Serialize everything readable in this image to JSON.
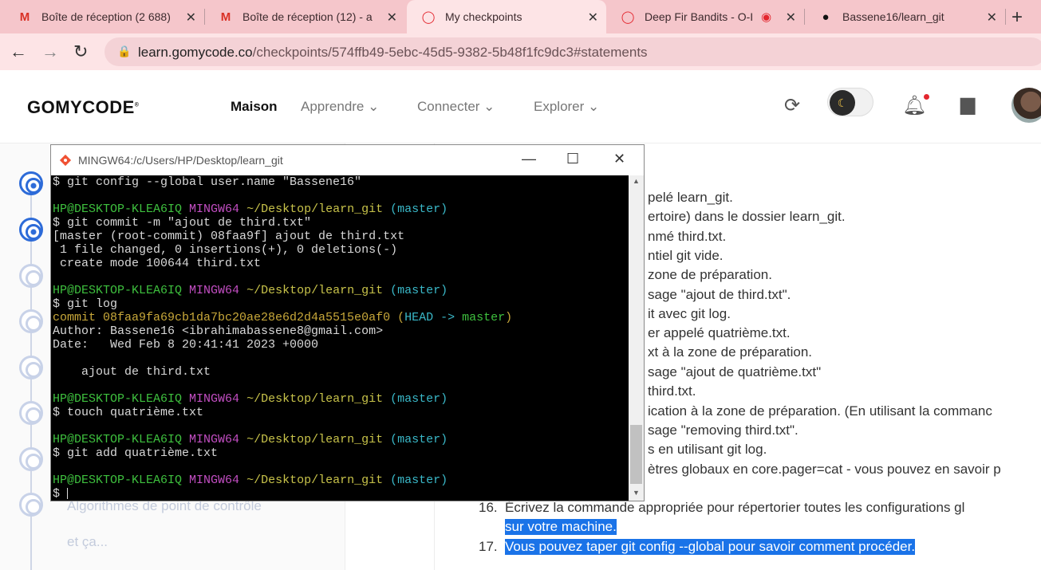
{
  "browser": {
    "tabs": [
      {
        "title": "Boîte de réception (2 688)",
        "icon": "gmail-icon"
      },
      {
        "title": "Boîte de réception (12) - a",
        "icon": "gmail-icon"
      },
      {
        "title": "My checkpoints",
        "icon": "gomycode-icon"
      },
      {
        "title": "Deep Fir Bandits - O-I",
        "icon": "gomycode-icon"
      },
      {
        "title": "Bassene16/learn_git",
        "icon": "github-icon"
      }
    ],
    "url_host": "learn.gomycode.co",
    "url_path": "/checkpoints/574ffb49-5ebc-45d5-9382-5b48f1fc9dc3#statements"
  },
  "site": {
    "logo": "GOMYCODE",
    "nav": [
      "Maison",
      "Apprendre",
      "Connecter",
      "Explorer"
    ]
  },
  "left": {
    "labels": [
      "Algorithmes de point de contrôle",
      "et ça..."
    ]
  },
  "statements": {
    "partial": [
      "pelé learn_git.",
      "ertoire) dans le dossier learn_git.",
      "nmé third.txt.",
      "ntiel git vide.",
      " zone de préparation.",
      "sage \"ajout de third.txt\".",
      "it avec git log.",
      "er appelé quatrième.txt.",
      "xt à la zone de préparation.",
      "sage \"ajout de quatrième.txt\"",
      " third.txt.",
      "ication à la zone de préparation. (En utilisant la commanc",
      "sage \"removing third.txt\".",
      "s en utilisant git log.",
      "ètres globaux en core.pager=cat - vous pouvez en savoir p"
    ],
    "item16_num": "16.",
    "item16_line1": "Écrivez la commande appropriée pour répertorier toutes les configurations gl",
    "item16_line2": "sur votre machine.",
    "item17_num": "17.",
    "item17_text": "Vous pouvez taper git config --global pour savoir comment procéder."
  },
  "terminal": {
    "title": "MINGW64:/c/Users/HP/Desktop/learn_git",
    "prompt_user": "HP@DESKTOP-KLEA6IQ",
    "prompt_env": "MINGW64",
    "prompt_path": "~/Desktop/learn_git",
    "prompt_branch": "(master)",
    "cmd1": "$ git config --global user.name \"Bassene16\"",
    "cmd2": "$ git commit -m \"ajout de third.txt\"",
    "out2a": "[master (root-commit) 08faa9f] ajout de third.txt",
    "out2b": " 1 file changed, 0 insertions(+), 0 deletions(-)",
    "out2c": " create mode 100644 third.txt",
    "cmd3": "$ git log",
    "commit": "commit 08faa9fa69cb1da7bc20ae28e6d2d4a5515e0af0",
    "head_open": "(",
    "head_ref": "HEAD -> ",
    "head_branch": "master",
    "head_close": ")",
    "author": "Author: Bassene16 <ibrahimabassene8@gmail.com>",
    "date": "Date:   Wed Feb 8 20:41:41 2023 +0000",
    "msg": "    ajout de third.txt",
    "cmd4": "$ touch quatrième.txt",
    "cmd5": "$ git add quatrième.txt",
    "cmd6": "$ "
  }
}
